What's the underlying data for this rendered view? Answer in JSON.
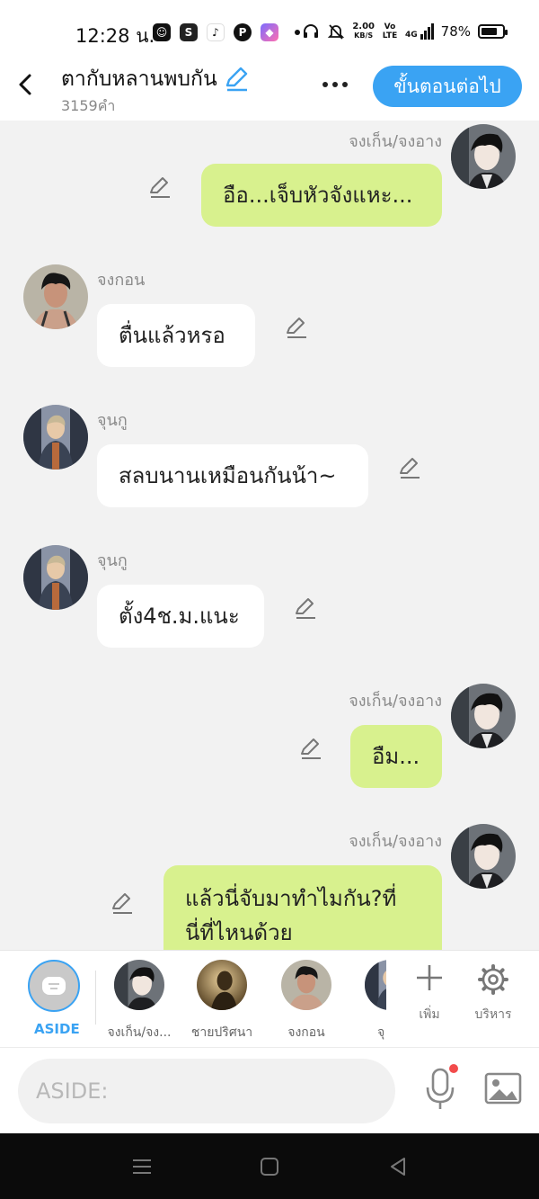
{
  "status_bar": {
    "time": "12:28 น.",
    "net_speed_value": "2.00",
    "net_speed_unit": "KB/S",
    "volte": "Vo LTE",
    "signal": "4G",
    "battery": "78%"
  },
  "header": {
    "title": "ตากับหลานพบกัน",
    "word_count": "3159คำ",
    "next_button": "ขั้นตอนต่อไป"
  },
  "messages": [
    {
      "side": "right",
      "speaker": "จงเก็น/จงอาง",
      "text": "อือ...เจ็บหัวจังแหะ..."
    },
    {
      "side": "left",
      "speaker": "จงกอน",
      "text": "ตื่นแล้วหรอ"
    },
    {
      "side": "left",
      "speaker": "จุนกู",
      "text": "สลบนานเหมือนกันน้า~"
    },
    {
      "side": "left",
      "speaker": "จุนกู",
      "text": "ตั้ง4ช.ม.แนะ"
    },
    {
      "side": "right",
      "speaker": "จงเก็น/จงอาง",
      "text": "อืม..."
    },
    {
      "side": "right",
      "speaker": "จงเก็น/จงอาง",
      "text_line1": "แล้วนี่จับมาทำไมกัน?ที่",
      "text_line2": "นี่ที่ไหนด้วย"
    }
  ],
  "character_bar": {
    "aside_label": "ASIDE",
    "characters": [
      {
        "label": "จงเก็น/จง..."
      },
      {
        "label": "ชายปริศนา"
      },
      {
        "label": "จงกอน"
      },
      {
        "label": "จุ"
      }
    ],
    "add_label": "เพิ่ม",
    "manage_label": "บริหาร"
  },
  "input": {
    "placeholder": "ASIDE:"
  },
  "colors": {
    "accent": "#3aa3f3",
    "bubble_right": "#d8f18e",
    "bubble_left": "#ffffff",
    "chat_bg": "#f2f2f2"
  }
}
